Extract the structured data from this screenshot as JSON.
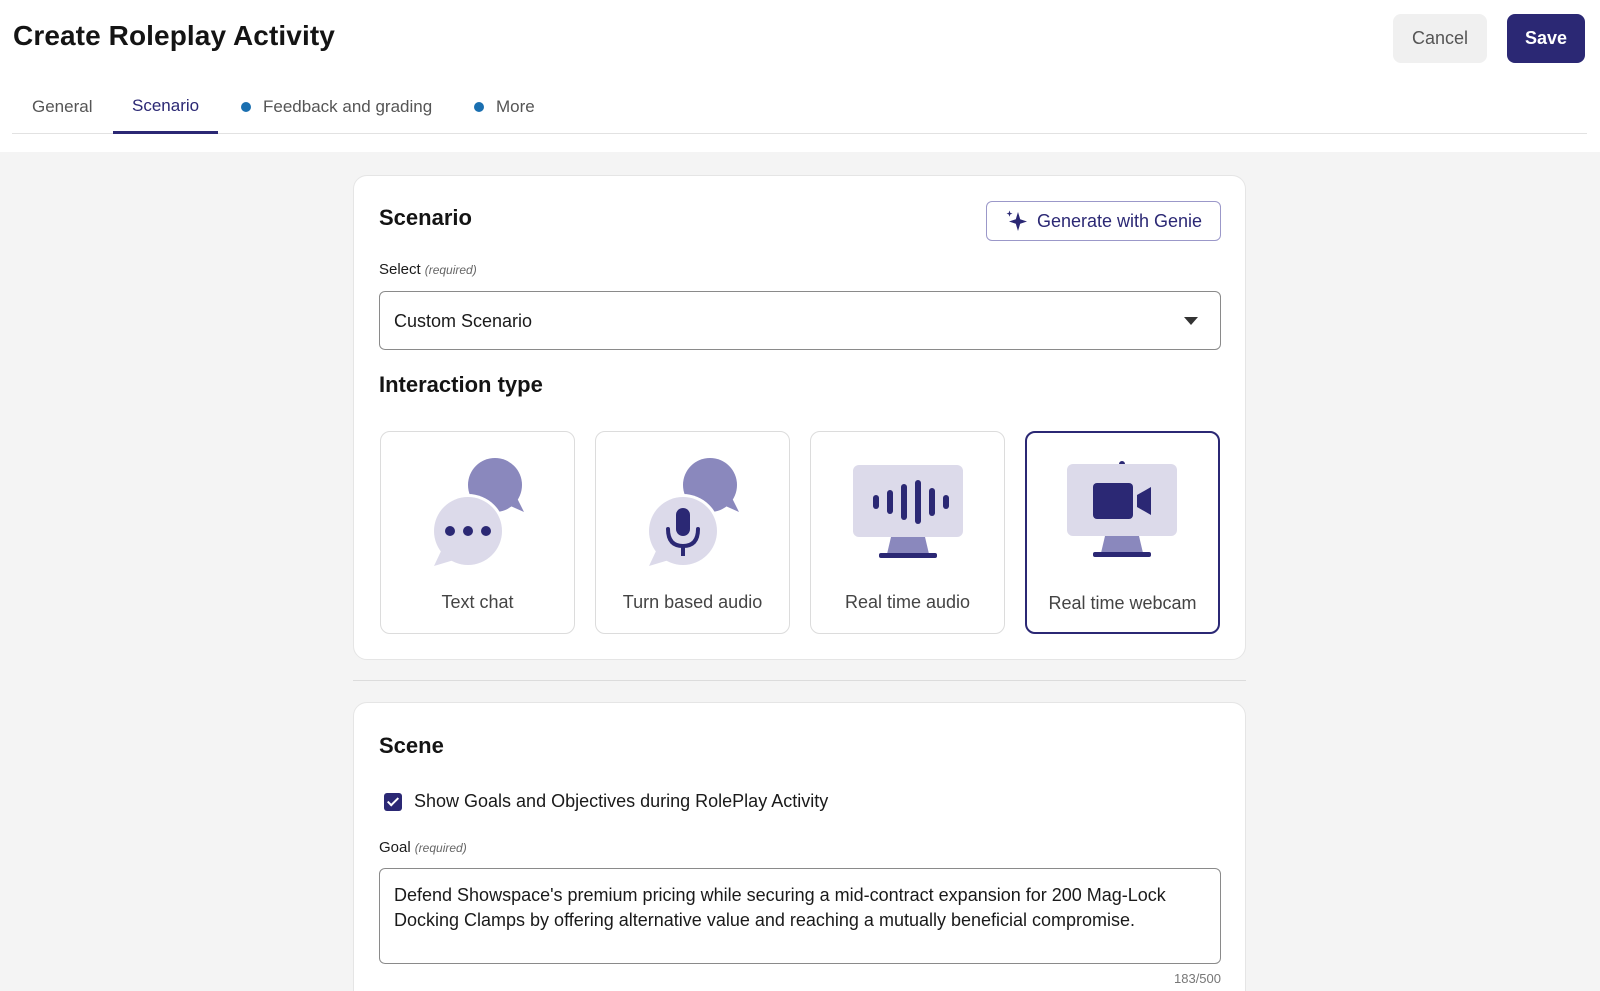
{
  "header": {
    "title": "Create Roleplay Activity",
    "cancel_label": "Cancel",
    "save_label": "Save"
  },
  "tabs": [
    {
      "label": "General",
      "active": false,
      "dot": false
    },
    {
      "label": "Scenario",
      "active": true,
      "dot": false
    },
    {
      "label": "Feedback and grading",
      "active": false,
      "dot": true
    },
    {
      "label": "More",
      "active": false,
      "dot": true
    }
  ],
  "scenario": {
    "title": "Scenario",
    "genie_label": "Generate with Genie",
    "select_label": "Select",
    "select_required": "(required)",
    "select_value": "Custom Scenario",
    "interaction_title": "Interaction type",
    "interaction_types": [
      {
        "label": "Text chat",
        "icon": "chat-bubbles-icon",
        "selected": false
      },
      {
        "label": "Turn based audio",
        "icon": "chat-microphone-icon",
        "selected": false
      },
      {
        "label": "Real time audio",
        "icon": "monitor-soundwave-icon",
        "selected": false
      },
      {
        "label": "Real time webcam",
        "icon": "monitor-webcam-icon",
        "selected": true
      }
    ]
  },
  "scene": {
    "title": "Scene",
    "checkbox_label": "Show Goals and Objectives during RolePlay Activity",
    "checkbox_checked": true,
    "goal_label": "Goal",
    "goal_required": "(required)",
    "goal_value": "Defend Showspace's premium pricing while securing a mid-contract expansion for 200 Mag-Lock Docking Clamps by offering alternative value and reaching a mutually beneficial compromise.",
    "goal_counter": "183/500"
  },
  "colors": {
    "primary": "#2b2874",
    "tab_dot": "#1a6fb0",
    "icon_light": "#dcdaea",
    "icon_mid": "#8a88bd",
    "background": "#f4f4f4"
  }
}
